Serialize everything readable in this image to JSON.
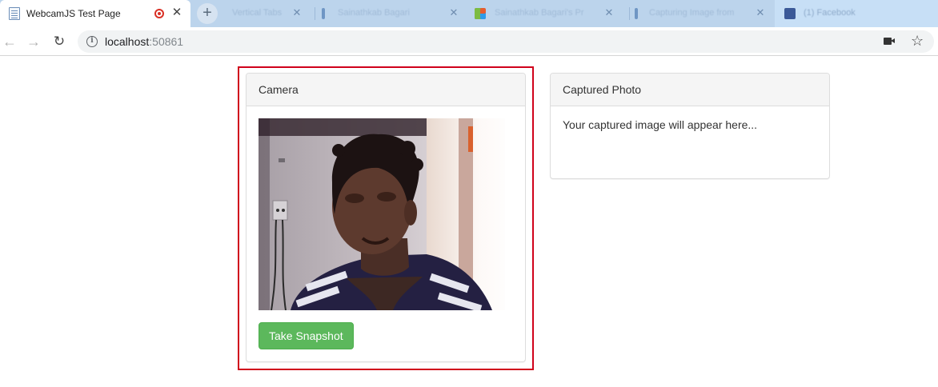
{
  "browser": {
    "active_tab": {
      "title": "WebcamJS Test Page"
    },
    "background_tabs": [
      {
        "title": "Vertical Tabs",
        "favicon_color": "#6f96c4"
      },
      {
        "title": "Sainathkab Bagari",
        "favicon_color": "#6f96c4"
      },
      {
        "title": "Sainathkab Bagari's Pr",
        "favicon_color": "#e65c2e"
      },
      {
        "title": "Capturing Image from",
        "favicon_color": "#6f96c4"
      },
      {
        "title": "(1) Facebook",
        "favicon_color": "#3b5998"
      }
    ],
    "url": {
      "host": "localhost",
      "port": ":50861"
    }
  },
  "camera_panel": {
    "heading": "Camera",
    "snapshot_button": "Take Snapshot"
  },
  "photo_panel": {
    "heading": "Captured Photo",
    "placeholder": "Your captured image will appear here..."
  },
  "colors": {
    "highlight": "#d0021b",
    "button": "#5cb85c",
    "tab_strip": "#bcd4ec"
  }
}
